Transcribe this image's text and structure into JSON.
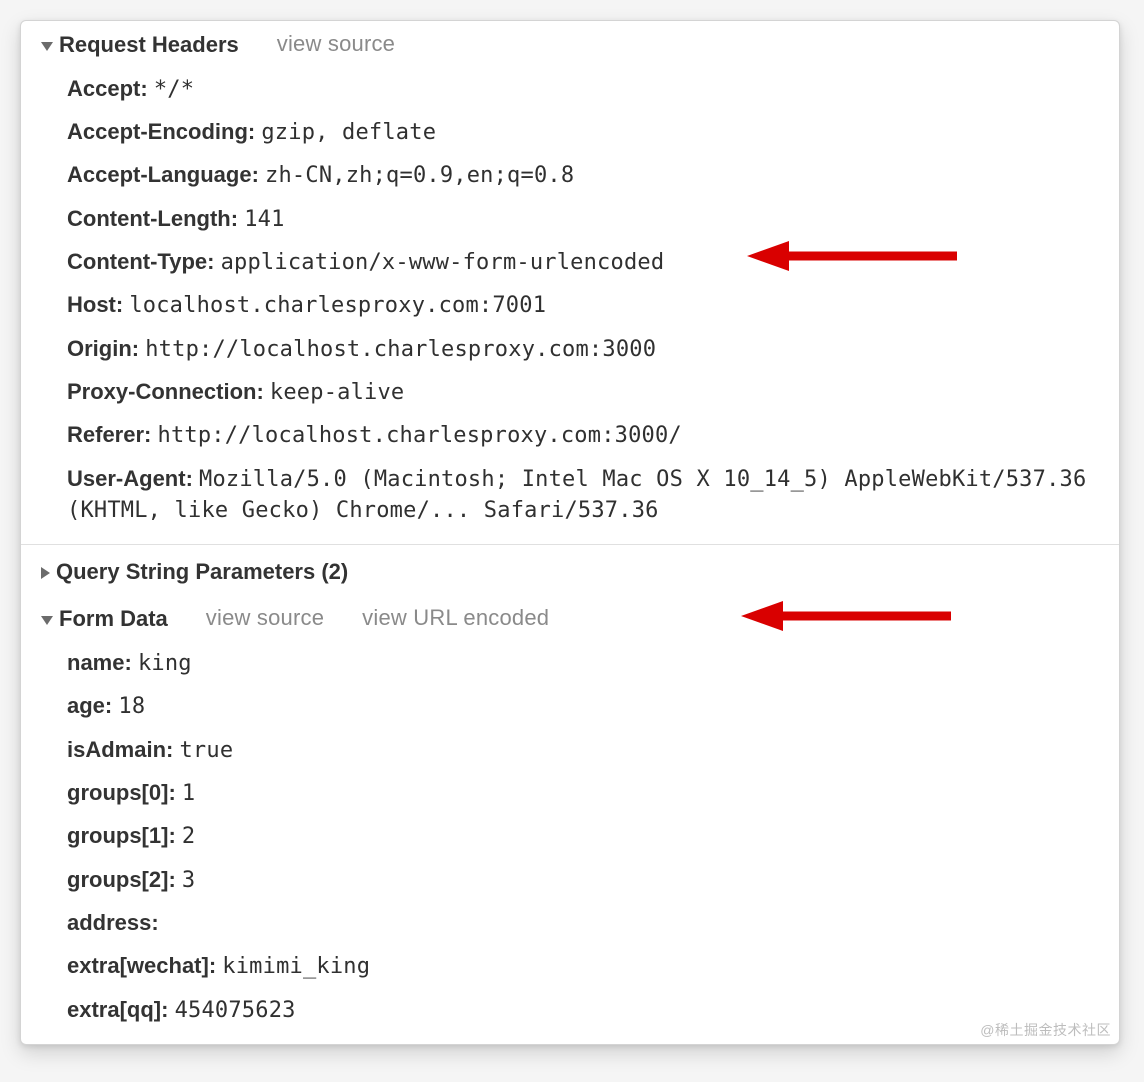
{
  "labels": {
    "view_source": "view source",
    "view_url_encoded": "view URL encoded"
  },
  "request_headers": {
    "title": "Request Headers",
    "items": [
      {
        "name": "Accept",
        "value": "*/*"
      },
      {
        "name": "Accept-Encoding",
        "value": "gzip, deflate"
      },
      {
        "name": "Accept-Language",
        "value": "zh-CN,zh;q=0.9,en;q=0.8"
      },
      {
        "name": "Content-Length",
        "value": "141"
      },
      {
        "name": "Content-Type",
        "value": "application/x-www-form-urlencoded"
      },
      {
        "name": "Host",
        "value": "localhost.charlesproxy.com:7001"
      },
      {
        "name": "Origin",
        "value": "http://localhost.charlesproxy.com:3000"
      },
      {
        "name": "Proxy-Connection",
        "value": "keep-alive"
      },
      {
        "name": "Referer",
        "value": "http://localhost.charlesproxy.com:3000/"
      },
      {
        "name": "User-Agent",
        "value": "Mozilla/5.0 (Macintosh; Intel Mac OS X 10_14_5) AppleWebKit/537.36 (KHTML, like Gecko) Chrome/... Safari/537.36",
        "wrap": true
      }
    ]
  },
  "query_string": {
    "title": "Query String Parameters (2)"
  },
  "form_data": {
    "title": "Form Data",
    "items": [
      {
        "name": "name",
        "value": "king"
      },
      {
        "name": "age",
        "value": "18"
      },
      {
        "name": "isAdmain",
        "value": "true"
      },
      {
        "name": "groups[0]",
        "value": "1"
      },
      {
        "name": "groups[1]",
        "value": "2"
      },
      {
        "name": "groups[2]",
        "value": "3"
      },
      {
        "name": "address",
        "value": ""
      },
      {
        "name": "extra[wechat]",
        "value": "kimimi_king"
      },
      {
        "name": "extra[qq]",
        "value": "454075623"
      }
    ]
  },
  "watermark": "@稀土掘金技术社区"
}
